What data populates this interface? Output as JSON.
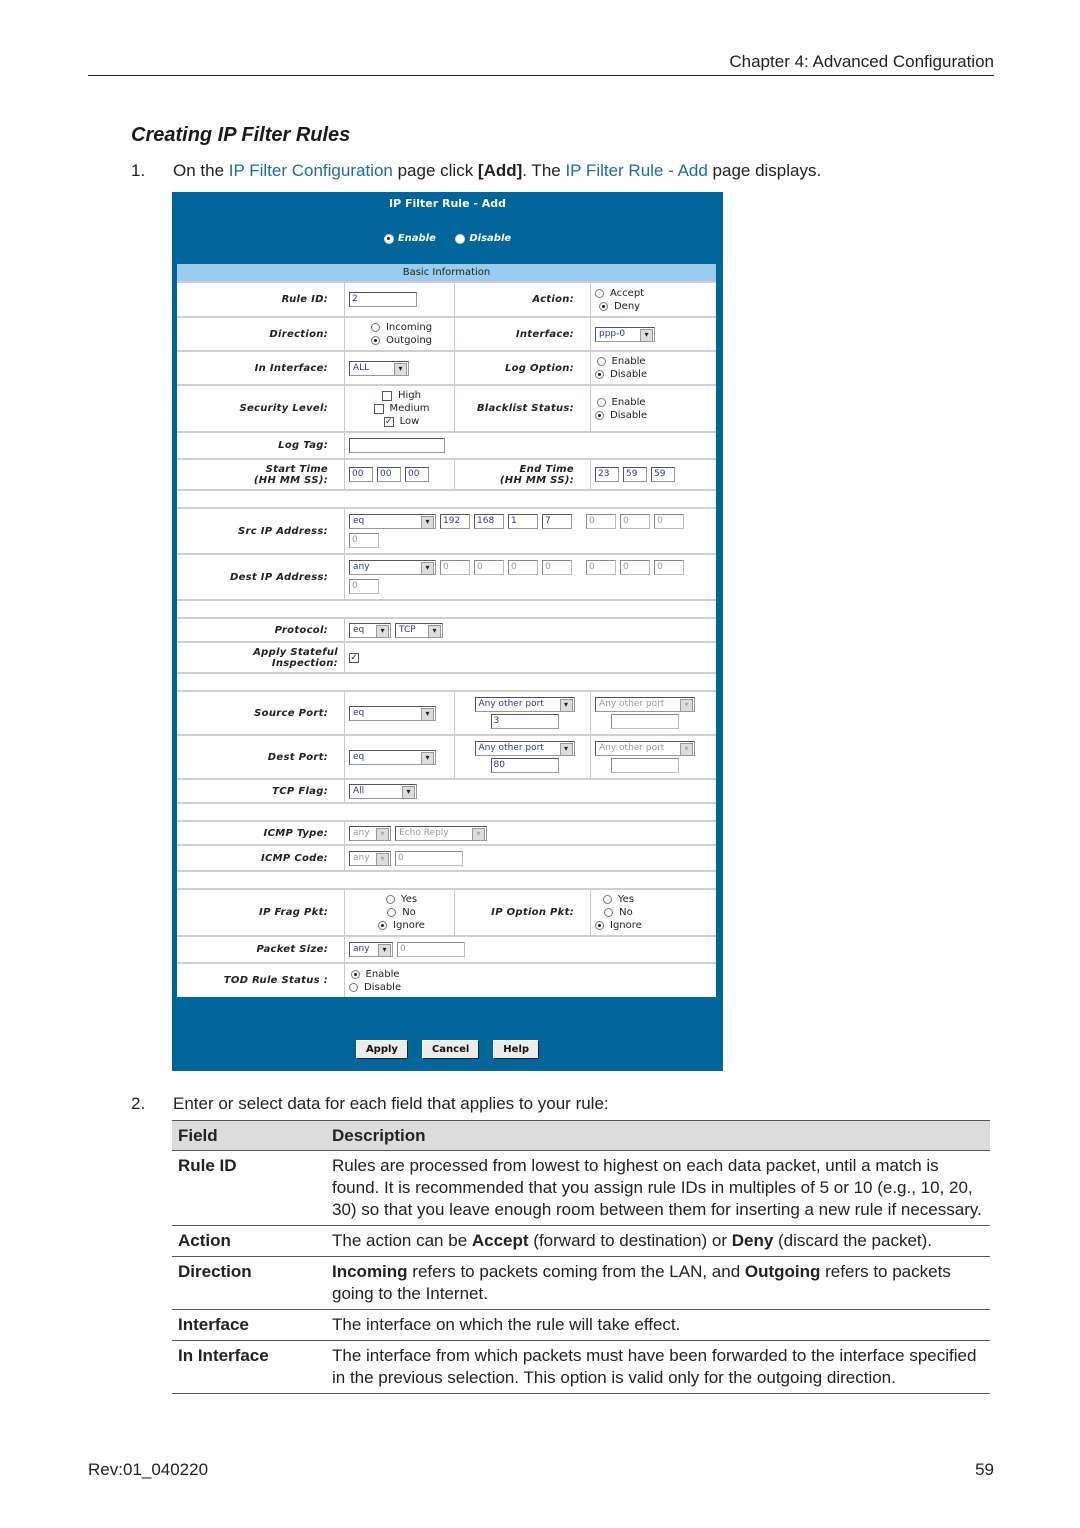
{
  "header": {
    "chapter": "Chapter 4: Advanced Configuration"
  },
  "section_title": "Creating IP Filter Rules",
  "step1": {
    "num": "1.",
    "t1": "On the ",
    "link1": "IP Filter Configuration",
    "t2": " page click ",
    "bold": "[Add]",
    "t3": ". The ",
    "link2": "IP Filter Rule - Add",
    "t4": " page displays."
  },
  "ui": {
    "title": "IP Filter Rule - Add",
    "status": {
      "enable": "Enable",
      "disable": "Disable",
      "selected": "Enable"
    },
    "section": "Basic Information",
    "rule_id": {
      "label": "Rule ID:",
      "value": "2"
    },
    "action": {
      "label": "Action:",
      "options": [
        "Accept",
        "Deny"
      ],
      "selected": "Deny"
    },
    "direction": {
      "label": "Direction:",
      "options": [
        "Incoming",
        "Outgoing"
      ],
      "selected": "Outgoing"
    },
    "interface": {
      "label": "Interface:",
      "value": "ppp-0"
    },
    "in_interface": {
      "label": "In Interface:",
      "value": "ALL"
    },
    "log_option": {
      "label": "Log Option:",
      "options": [
        "Enable",
        "Disable"
      ],
      "selected": "Disable"
    },
    "security_level": {
      "label": "Security Level:",
      "options": [
        "High",
        "Medium",
        "Low"
      ],
      "checked": [
        "Low"
      ]
    },
    "blacklist_status": {
      "label": "Blacklist Status:",
      "options": [
        "Enable",
        "Disable"
      ],
      "selected": "Disable"
    },
    "log_tag": {
      "label": "Log Tag:",
      "value": ""
    },
    "start_time": {
      "label1": "Start Time",
      "label2": "(HH MM SS):",
      "hh": "00",
      "mm": "00",
      "ss": "00"
    },
    "end_time": {
      "label1": "End Time",
      "label2": "(HH MM SS):",
      "hh": "23",
      "mm": "59",
      "ss": "59"
    },
    "src_ip": {
      "label": "Src IP Address:",
      "op": "eq",
      "ip1": [
        "192",
        "168",
        "1",
        "7"
      ],
      "ip2": [
        "0",
        "0",
        "0",
        "0"
      ]
    },
    "dest_ip": {
      "label": "Dest IP Address:",
      "op": "any",
      "ip1": [
        "0",
        "0",
        "0",
        "0"
      ],
      "ip2": [
        "0",
        "0",
        "0",
        "0"
      ]
    },
    "protocol": {
      "label": "Protocol:",
      "op": "eq",
      "value": "TCP"
    },
    "stateful": {
      "label1": "Apply Stateful",
      "label2": "Inspection:",
      "checked": true
    },
    "source_port": {
      "label": "Source Port:",
      "op": "eq",
      "port1": "Any other port",
      "port1_value": "3",
      "port2": "Any other port",
      "port2_value": ""
    },
    "dest_port": {
      "label": "Dest Port:",
      "op": "eq",
      "port1": "Any other port",
      "port1_value": "80",
      "port2": "Any other port",
      "port2_value": ""
    },
    "tcp_flag": {
      "label": "TCP Flag:",
      "value": "All"
    },
    "icmp_type": {
      "label": "ICMP Type:",
      "op": "any",
      "value": "Echo Reply"
    },
    "icmp_code": {
      "label": "ICMP Code:",
      "op": "any",
      "value": "0"
    },
    "ip_frag": {
      "label": "IP Frag Pkt:",
      "options": [
        "Yes",
        "No",
        "Ignore"
      ],
      "selected": "Ignore"
    },
    "ip_option": {
      "label": "IP Option Pkt:",
      "options": [
        "Yes",
        "No",
        "Ignore"
      ],
      "selected": "Ignore"
    },
    "packet_size": {
      "label": "Packet Size:",
      "op": "any",
      "value": "0"
    },
    "tod_status": {
      "label": "TOD Rule Status :",
      "options": [
        "Enable",
        "Disable"
      ],
      "selected": "Enable"
    },
    "buttons": {
      "apply": "Apply",
      "cancel": "Cancel",
      "help": "Help"
    }
  },
  "step2": {
    "num": "2.",
    "text": "Enter or select data for each field that applies to your rule:"
  },
  "table": {
    "headers": [
      "Field",
      "Description"
    ],
    "rows": [
      {
        "field": "Rule ID",
        "desc": "Rules are processed from lowest to highest on each data packet, until a match is found. It is recommended that you assign rule IDs in multiples of 5 or 10 (e.g., 10, 20, 30) so that you leave enough room between them for inserting a new rule if necessary."
      },
      {
        "field": "Action",
        "d1": "The action can be ",
        "b1": "Accept",
        "d2": " (forward to destination) or ",
        "b2": "Deny",
        "d3": " (discard the packet)."
      },
      {
        "field": "Direction",
        "b1": "Incoming",
        "d1": " refers to packets coming from the LAN, and ",
        "b2": "Outgoing",
        "d2": " refers to packets going to the Internet."
      },
      {
        "field": "Interface",
        "desc": "The interface on which the rule will take effect."
      },
      {
        "field": "In Interface",
        "desc": "The interface from which packets must have been forwarded to the interface specified in the previous selection. This option is valid only for the outgoing direction."
      }
    ]
  },
  "footer": {
    "rev": "Rev:01_040220",
    "page": "59"
  }
}
